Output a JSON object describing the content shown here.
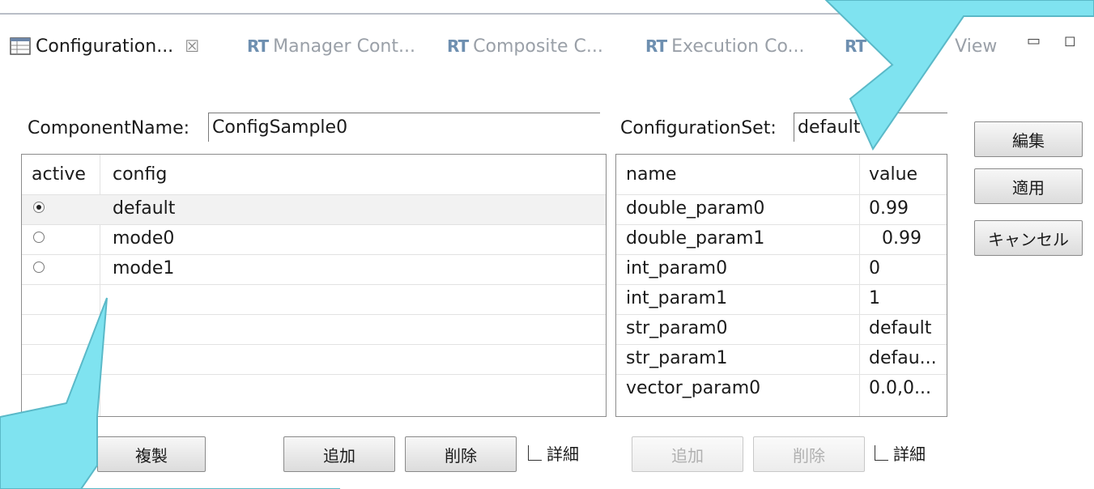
{
  "tabs": [
    {
      "label": "Configuration...",
      "icon": "table-icon",
      "active": true,
      "close": "☒"
    },
    {
      "label": "Manager Cont...",
      "icon": "rt-icon",
      "active": false
    },
    {
      "label": "Composite C...",
      "icon": "rt-icon",
      "active": false
    },
    {
      "label": "Execution Co...",
      "icon": "rt-icon",
      "active": false
    },
    {
      "label": "View",
      "icon": "rt-icon",
      "active": false
    }
  ],
  "rt_icon_text": "RT",
  "window_controls": {
    "minimize": "▭",
    "maximize": "◻"
  },
  "component": {
    "label": "ComponentName:",
    "value": "ConfigSample0"
  },
  "configset": {
    "label": "ConfigurationSet:",
    "value": "default"
  },
  "config_table": {
    "headers": {
      "active": "active",
      "config": "config"
    },
    "rows": [
      {
        "config": "default",
        "active": true
      },
      {
        "config": "mode0",
        "active": false
      },
      {
        "config": "mode1",
        "active": false
      }
    ]
  },
  "param_table": {
    "headers": {
      "name": "name",
      "value": "value"
    },
    "rows": [
      {
        "name": "double_param0",
        "value": "0.99"
      },
      {
        "name": "double_param1",
        "value": "0.99"
      },
      {
        "name": "int_param0",
        "value": "0"
      },
      {
        "name": "int_param1",
        "value": "1"
      },
      {
        "name": "str_param0",
        "value": "default"
      },
      {
        "name": "str_param1",
        "value": "defau..."
      },
      {
        "name": "vector_param0",
        "value": "0.0,0..."
      }
    ]
  },
  "side_buttons": {
    "edit": "編集",
    "apply": "適用",
    "cancel": "キャンセル"
  },
  "left_buttons": {
    "copy": "複製",
    "add": "追加",
    "delete": "削除",
    "detail": "詳細"
  },
  "right_buttons": {
    "add": "追加",
    "delete": "削除",
    "detail": "詳細"
  },
  "colors": {
    "callout": "#7fe3f0",
    "callout_border": "#5ab9c8"
  }
}
